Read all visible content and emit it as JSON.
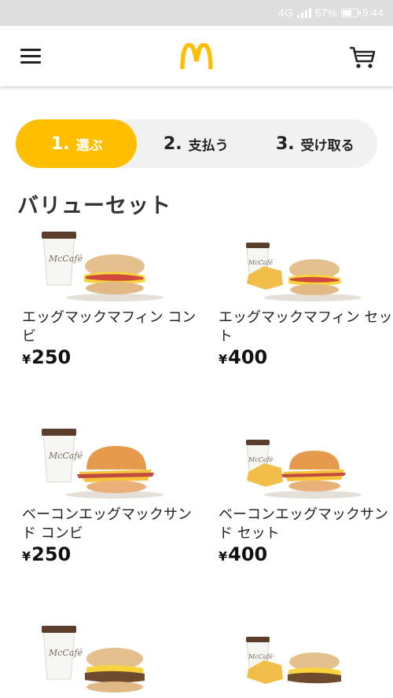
{
  "status_bar": {
    "network": "4G",
    "battery": "67%",
    "battery_level": 0.67,
    "time": "9:44"
  },
  "header": {
    "menu_icon": "hamburger-menu-icon",
    "logo": "mcdonalds-golden-arches-logo",
    "cart_icon": "shopping-cart-icon"
  },
  "steps": [
    {
      "number": "1.",
      "label": "選ぶ",
      "active": true
    },
    {
      "number": "2.",
      "label": "支払う",
      "active": false
    },
    {
      "number": "3.",
      "label": "受け取る",
      "active": false
    }
  ],
  "section_title": "バリューセット",
  "products": [
    {
      "name": "エッグマックマフィン コンビ",
      "currency": "¥",
      "price": "250"
    },
    {
      "name": "エッグマックマフィン セット",
      "currency": "¥",
      "price": "400"
    },
    {
      "name": "ベーコンエッグマックサンド コンビ",
      "currency": "¥",
      "price": "250"
    },
    {
      "name": "ベーコンエッグマックサンド セット",
      "currency": "¥",
      "price": "400"
    }
  ],
  "colors": {
    "accent": "#ffbf00",
    "step_track": "#f1f1f1",
    "status_bar": "#dedede"
  }
}
